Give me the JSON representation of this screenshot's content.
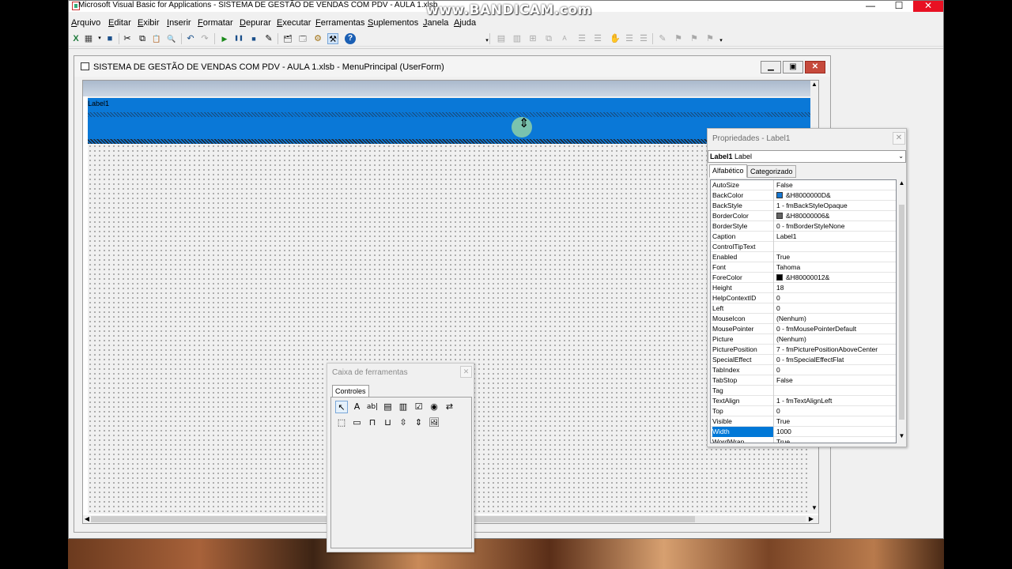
{
  "app": {
    "title": "Microsoft Visual Basic for Applications - SISTEMA DE GESTÃO DE VENDAS COM PDV - AULA 1.xlsb",
    "watermark": "www.BANDICAM.com",
    "min_glyph": "—",
    "max_glyph": "☐",
    "close_glyph": "✕"
  },
  "menu": [
    "Arquivo",
    "Editar",
    "Exibir",
    "Inserir",
    "Formatar",
    "Depurar",
    "Executar",
    "Ferramentas",
    "Suplementos",
    "Janela",
    "Ajuda"
  ],
  "toolbar": {
    "excel_glyph": "X",
    "insert_glyph": "▦",
    "save_glyph": "■",
    "cut_glyph": "✂",
    "copy_glyph": "⧉",
    "paste_glyph": "📋",
    "find_glyph": "🔍",
    "undo_glyph": "↶",
    "redo_glyph": "↷",
    "run_glyph": "▶",
    "break_glyph": "❚❚",
    "reset_glyph": "■",
    "design_glyph": "✎",
    "project_glyph": "🗂",
    "props_glyph": "🗔",
    "objbrowser_glyph": "⚙",
    "toolbox_glyph": "⚒",
    "help_glyph": "?",
    "more_glyph": "▾"
  },
  "form_window": {
    "title": "SISTEMA DE GESTÃO DE VENDAS COM PDV - AULA 1.xlsb - MenuPrincipal (UserForm)",
    "label_caption": "Label1",
    "min_glyph": "▁",
    "max_glyph": "▣",
    "close_glyph": "✕",
    "cursor_glyph": "⇕"
  },
  "scroll": {
    "up": "▲",
    "down": "▼",
    "left": "◀",
    "right": "▶"
  },
  "properties": {
    "title": "Propriedades - Label1",
    "close_glyph": "✕",
    "object_name": "Label1",
    "object_type": "Label",
    "dropdown_glyph": "⌄",
    "tabs": [
      "Alfabético",
      "Categorizado"
    ],
    "rows": [
      {
        "name": "AutoSize",
        "value": "False"
      },
      {
        "name": "BackColor",
        "value": "&H8000000D&",
        "swatch": "#1677d2"
      },
      {
        "name": "BackStyle",
        "value": "1 - fmBackStyleOpaque"
      },
      {
        "name": "BorderColor",
        "value": "&H80000006&",
        "swatch": "#646464"
      },
      {
        "name": "BorderStyle",
        "value": "0 - fmBorderStyleNone"
      },
      {
        "name": "Caption",
        "value": "Label1"
      },
      {
        "name": "ControlTipText",
        "value": ""
      },
      {
        "name": "Enabled",
        "value": "True"
      },
      {
        "name": "Font",
        "value": "Tahoma"
      },
      {
        "name": "ForeColor",
        "value": "&H80000012&",
        "swatch": "#000000"
      },
      {
        "name": "Height",
        "value": "18"
      },
      {
        "name": "HelpContextID",
        "value": "0"
      },
      {
        "name": "Left",
        "value": "0"
      },
      {
        "name": "MouseIcon",
        "value": "(Nenhum)"
      },
      {
        "name": "MousePointer",
        "value": "0 - fmMousePointerDefault"
      },
      {
        "name": "Picture",
        "value": "(Nenhum)"
      },
      {
        "name": "PicturePosition",
        "value": "7 - fmPicturePositionAboveCenter"
      },
      {
        "name": "SpecialEffect",
        "value": "0 - fmSpecialEffectFlat"
      },
      {
        "name": "TabIndex",
        "value": "0"
      },
      {
        "name": "TabStop",
        "value": "False"
      },
      {
        "name": "Tag",
        "value": ""
      },
      {
        "name": "TextAlign",
        "value": "1 - fmTextAlignLeft"
      },
      {
        "name": "Top",
        "value": "0"
      },
      {
        "name": "Visible",
        "value": "True"
      },
      {
        "name": "Width",
        "value": "1000",
        "selected": true
      },
      {
        "name": "WordWrap",
        "value": "True"
      }
    ]
  },
  "toolbox": {
    "title": "Caixa de ferramentas",
    "close_glyph": "✕",
    "tab": "Controles",
    "controls": [
      {
        "name": "pointer-icon",
        "glyph": "↖"
      },
      {
        "name": "label-tool-icon",
        "glyph": "A"
      },
      {
        "name": "textbox-tool-icon",
        "glyph": "ab|"
      },
      {
        "name": "combobox-tool-icon",
        "glyph": "▤"
      },
      {
        "name": "listbox-tool-icon",
        "glyph": "▥"
      },
      {
        "name": "checkbox-tool-icon",
        "glyph": "☑"
      },
      {
        "name": "optionbutton-tool-icon",
        "glyph": "◉"
      },
      {
        "name": "togglebutton-tool-icon",
        "glyph": "⇄"
      },
      {
        "name": "frame-tool-icon",
        "glyph": "⬚"
      },
      {
        "name": "commandbutton-tool-icon",
        "glyph": "▭"
      },
      {
        "name": "tabstrip-tool-icon",
        "glyph": "⊓"
      },
      {
        "name": "multipage-tool-icon",
        "glyph": "⊔"
      },
      {
        "name": "scrollbar-tool-icon",
        "glyph": "⇳"
      },
      {
        "name": "spinbutton-tool-icon",
        "glyph": "⇕"
      },
      {
        "name": "image-tool-icon",
        "glyph": "🖼"
      }
    ]
  }
}
